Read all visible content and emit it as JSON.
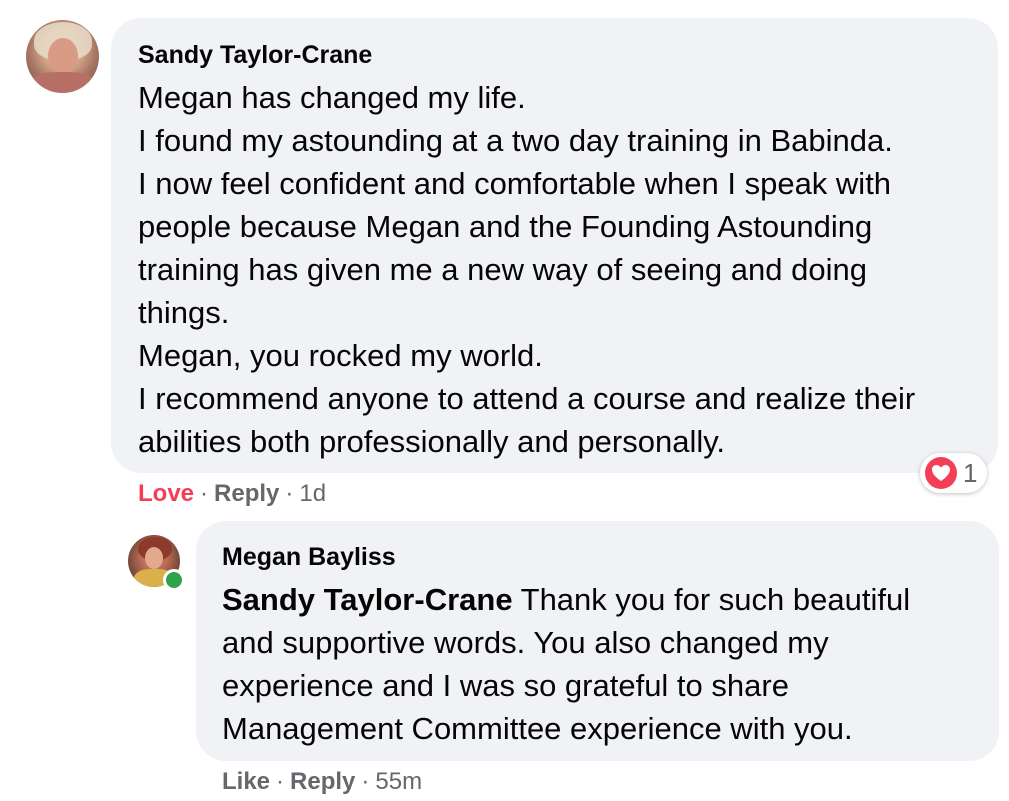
{
  "comment": {
    "author": "Sandy Taylor-Crane",
    "lines": [
      "Megan has changed my life.",
      "I found my astounding at a two day training in Babinda.",
      "I now feel confident and comfortable when I speak with",
      "people because Megan and the Founding Astounding",
      "training has given me a new way of seeing and doing",
      "things.",
      "Megan, you rocked my world.",
      "I recommend anyone to attend a course and realize their",
      "abilities both professionally and personally."
    ],
    "reaction": {
      "icon": "heart-icon",
      "count": "1",
      "color": "#f33e58"
    },
    "actions": {
      "love": "Love",
      "reply": "Reply",
      "time": "1d",
      "separator": "·"
    }
  },
  "reply": {
    "author": "Megan Bayliss",
    "mention": "Sandy Taylor-Crane",
    "lines": [
      " Thank you for such beautiful",
      "and supportive words. You also changed my",
      "experience and I was so grateful to share",
      "Management Committee experience with you."
    ],
    "online": true,
    "actions": {
      "like": "Like",
      "reply": "Reply",
      "time": "55m",
      "separator": "·"
    }
  },
  "colors": {
    "bubble": "#f0f2f5",
    "secondary_text": "#65676b",
    "online": "#31a24c"
  }
}
